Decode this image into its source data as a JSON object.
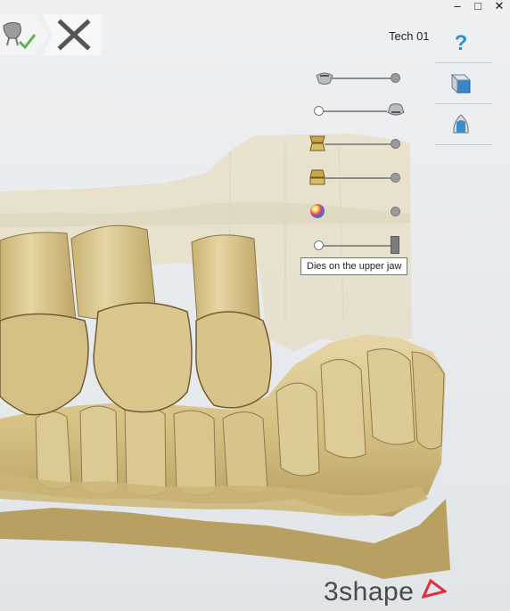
{
  "window": {
    "minimize_glyph": "–",
    "maximize_glyph": "□",
    "close_glyph": "✕"
  },
  "toolbar": {
    "accept_icon": "tooth-check-icon",
    "close_icon": "close-x-icon"
  },
  "user": {
    "name": "Tech 01"
  },
  "rail": {
    "help_glyph": "?",
    "items": [
      "help-icon",
      "view-cube-icon",
      "die-view-icon"
    ]
  },
  "sliders": [
    {
      "icon": "lower-jaw-icon",
      "level": 1.0
    },
    {
      "icon": "upper-jaw-icon",
      "level": 0.0
    },
    {
      "icon": "die-upper-icon",
      "level": 1.0
    },
    {
      "icon": "die-lower-icon",
      "level": 1.0
    },
    {
      "icon": "color-sphere-icon",
      "level": 1.0
    },
    {
      "icon": "dies-upper-jaw-slider",
      "level": 1.0
    }
  ],
  "tooltip": {
    "text": "Dies on the upper jaw"
  },
  "brand": {
    "logo_text": "3shape"
  },
  "colors": {
    "model": "#d9c58f",
    "model_shadow": "#a48d55",
    "accent_green": "#5cb54a",
    "accent_blue": "#2a8fd6",
    "logo_red": "#e0303e"
  }
}
